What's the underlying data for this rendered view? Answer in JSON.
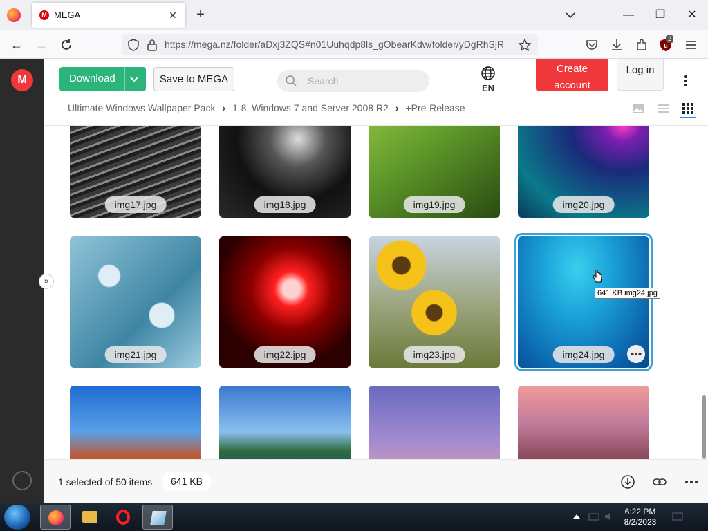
{
  "browser": {
    "tab_title": "MEGA",
    "tab_favicon": "M",
    "url": "https://mega.nz/folder/aDxj3ZQS#n01Uuhqdp8ls_gObearKdw/folder/yDgRhSjR",
    "ublock_count": "2"
  },
  "header": {
    "download_label": "Download",
    "save_label": "Save to MEGA",
    "search_placeholder": "Search",
    "language": "EN",
    "create_account_line1": "Create",
    "create_account_line2": "account",
    "login_label": "Log in",
    "brand_letter": "M"
  },
  "breadcrumb": [
    "Ultimate Windows Wallpaper Pack",
    "1-8. Windows 7 and Server 2008 R2",
    "+Pre-Release"
  ],
  "files": [
    {
      "name": "img17.jpg"
    },
    {
      "name": "img18.jpg"
    },
    {
      "name": "img19.jpg"
    },
    {
      "name": "img20.jpg"
    },
    {
      "name": "img21.jpg"
    },
    {
      "name": "img22.jpg"
    },
    {
      "name": "img23.jpg"
    },
    {
      "name": "img24.jpg",
      "selected": true
    },
    {
      "name": ""
    },
    {
      "name": ""
    },
    {
      "name": ""
    },
    {
      "name": ""
    }
  ],
  "tooltip": "641 KB img24.jpg",
  "footer": {
    "selection": "1 selected of 50 items",
    "size": "641 KB"
  },
  "taskbar": {
    "time": "6:22 PM",
    "date": "8/2/2023"
  },
  "colors": {
    "download_green": "#2bb57b",
    "mega_red": "#f0373a",
    "selection_blue": "#3aa3d8"
  },
  "icons": {
    "favicon": "mega-favicon",
    "back": "arrow-left-icon",
    "forward": "arrow-right-icon",
    "reload": "reload-icon",
    "shield": "shield-icon",
    "lock": "lock-icon",
    "bookmark": "star-icon",
    "pocket": "pocket-icon",
    "downloads": "download-arrow-icon",
    "extensions": "puzzle-icon",
    "ublock": "ublock-icon",
    "menu": "hamburger-icon",
    "globe": "globe-icon",
    "kebab": "more-vertical-icon",
    "thumbnail_view": "image-icon",
    "list_view": "list-icon",
    "grid_view": "grid-icon",
    "download_footer": "download-circle-icon",
    "link": "link-icon",
    "more": "more-horizontal-icon"
  }
}
